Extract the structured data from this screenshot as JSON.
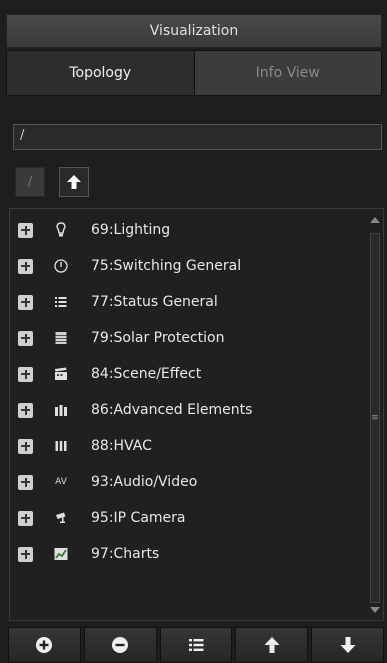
{
  "header": {
    "title": "Visualization"
  },
  "tabs": [
    {
      "label": "Topology",
      "active": true
    },
    {
      "label": "Info View",
      "active": false
    }
  ],
  "path": {
    "value": "/"
  },
  "nav": {
    "root_label": "/"
  },
  "items": [
    {
      "label": "69:Lighting",
      "icon": "lightbulb-icon"
    },
    {
      "label": "75:Switching General",
      "icon": "power-icon"
    },
    {
      "label": "77:Status General",
      "icon": "status-list-icon"
    },
    {
      "label": "79:Solar Protection",
      "icon": "blind-icon"
    },
    {
      "label": "84:Scene/Effect",
      "icon": "clapperboard-icon"
    },
    {
      "label": "86:Advanced Elements",
      "icon": "advanced-elements-icon"
    },
    {
      "label": "88:HVAC",
      "icon": "hvac-icon"
    },
    {
      "label": "93:Audio/Video",
      "icon": "av-icon",
      "icon_text": "AV"
    },
    {
      "label": "95:IP Camera",
      "icon": "camera-icon"
    },
    {
      "label": "97:Charts",
      "icon": "chart-icon"
    }
  ],
  "colors": {
    "background": "#1e1e1e",
    "text": "#e8e8e8",
    "inactive_tab_text": "#8a8a8a"
  }
}
